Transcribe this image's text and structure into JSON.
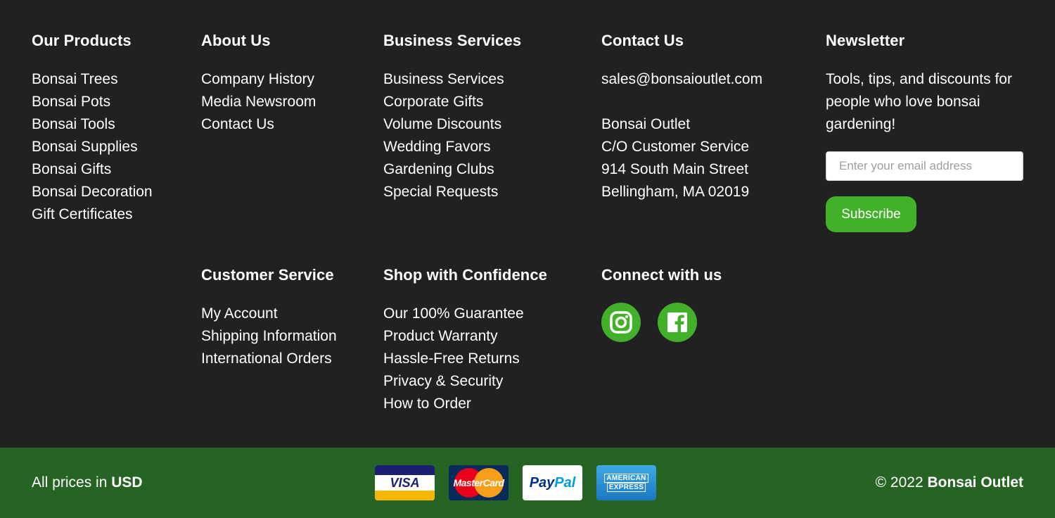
{
  "products": {
    "heading": "Our Products",
    "links": [
      "Bonsai Trees",
      "Bonsai Pots",
      "Bonsai Tools",
      "Bonsai Supplies",
      "Bonsai Gifts",
      "Bonsai Decoration",
      "Gift Certificates"
    ]
  },
  "about": {
    "heading": "About Us",
    "links": [
      "Company History",
      "Media Newsroom",
      "Contact Us"
    ]
  },
  "business": {
    "heading": "Business Services",
    "links": [
      "Business Services",
      "Corporate Gifts",
      "Volume Discounts",
      "Wedding Favors",
      "Gardening Clubs",
      "Special Requests"
    ]
  },
  "contact": {
    "heading": "Contact Us",
    "email": "sales@bonsaioutlet.com",
    "address": [
      "Bonsai Outlet",
      "C/O Customer Service",
      "914 South Main Street",
      "Bellingham, MA 02019"
    ]
  },
  "newsletter": {
    "heading": "Newsletter",
    "text": "Tools, tips, and discounts for people who love bonsai gardening!",
    "placeholder": "Enter your email address",
    "button": "Subscribe"
  },
  "customer_service": {
    "heading": "Customer Service",
    "links": [
      "My Account",
      "Shipping Information",
      "International Orders"
    ]
  },
  "confidence": {
    "heading": "Shop with Confidence",
    "links": [
      "Our 100% Guarantee",
      "Product Warranty",
      "Hassle-Free Returns",
      "Privacy & Security",
      "How to Order"
    ]
  },
  "connect": {
    "heading": "Connect with us",
    "icons": [
      "instagram-icon",
      "facebook-icon"
    ]
  },
  "bottom": {
    "prices_prefix": "All prices in ",
    "currency": "USD",
    "copyright_prefix": "© 2022 ",
    "brand": "Bonsai Outlet",
    "cards": {
      "visa": "VISA",
      "mastercard": "MasterCard",
      "paypal_a": "Pay",
      "paypal_b": "Pal",
      "amex_a": "AMERICAN",
      "amex_b": "EXPRESS"
    }
  },
  "colors": {
    "background": "#212121",
    "accent_green": "#43b02a",
    "bottom_bar": "#256422"
  }
}
